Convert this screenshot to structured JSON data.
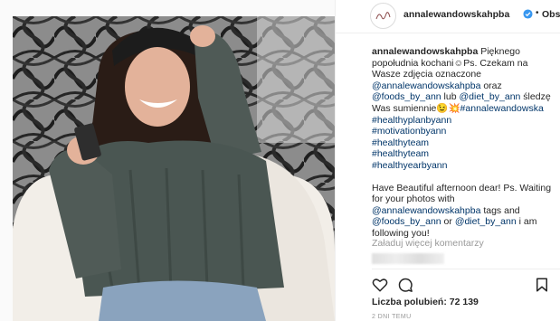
{
  "header": {
    "username": "annalewandowskahpba",
    "follow_label": "Obser",
    "separator": "•"
  },
  "caption": {
    "lines": [
      [
        {
          "text": "annalewandowskahpba",
          "kind": "user"
        },
        {
          "text": " Pięknego",
          "kind": "text"
        }
      ],
      [
        {
          "text": "popołudnia kochani",
          "kind": "text"
        },
        {
          "text": "☺",
          "kind": "text"
        },
        {
          "text": "Ps. Czekam na",
          "kind": "text"
        }
      ],
      [
        {
          "text": "Wasze zdjęcia oznaczone",
          "kind": "text"
        }
      ],
      [
        {
          "text": "@annalewandowskahpba",
          "kind": "link"
        },
        {
          "text": " oraz",
          "kind": "text"
        }
      ],
      [
        {
          "text": "@foods_by_ann",
          "kind": "link"
        },
        {
          "text": " lub ",
          "kind": "text"
        },
        {
          "text": "@diet_by_ann",
          "kind": "link"
        },
        {
          "text": " śledzę",
          "kind": "text"
        }
      ],
      [
        {
          "text": "Was sumiennie",
          "kind": "text"
        },
        {
          "text": "😉💥",
          "kind": "text"
        },
        {
          "text": "#annalewandowska",
          "kind": "link"
        }
      ],
      [
        {
          "text": "#healthyplanbyann",
          "kind": "link"
        }
      ],
      [
        {
          "text": "#motivationbyann",
          "kind": "link"
        }
      ],
      [
        {
          "text": "#healthyteam",
          "kind": "link"
        }
      ],
      [
        {
          "text": "#healthyteam",
          "kind": "link"
        }
      ],
      [
        {
          "text": "#healthyearbyann",
          "kind": "link"
        }
      ],
      [],
      [
        {
          "text": "Have Beautiful afternoon dear! Ps. Waiting",
          "kind": "text"
        }
      ],
      [
        {
          "text": "for your photos with",
          "kind": "text"
        }
      ],
      [
        {
          "text": "@annalewandowskahpba",
          "kind": "link"
        },
        {
          "text": " tags and",
          "kind": "text"
        }
      ],
      [
        {
          "text": "@foods_by_ann",
          "kind": "link"
        },
        {
          "text": " or ",
          "kind": "text"
        },
        {
          "text": "@diet_by_ann",
          "kind": "link"
        },
        {
          "text": " i am",
          "kind": "text"
        }
      ],
      [
        {
          "text": "following you!",
          "kind": "text"
        }
      ]
    ]
  },
  "comments": {
    "load_more_label": "Załaduj więcej komentarzy"
  },
  "actions": {
    "icons": [
      "heart-icon",
      "comment-icon",
      "bookmark-icon"
    ]
  },
  "likes": {
    "label": "Liczba polubień:",
    "count": "72 139"
  },
  "timestamp": "2 DNI TEMU",
  "colors": {
    "link": "#003569",
    "text": "#262626",
    "muted": "#999999",
    "verified": "#3897f0",
    "sweater": "#4a5652"
  }
}
